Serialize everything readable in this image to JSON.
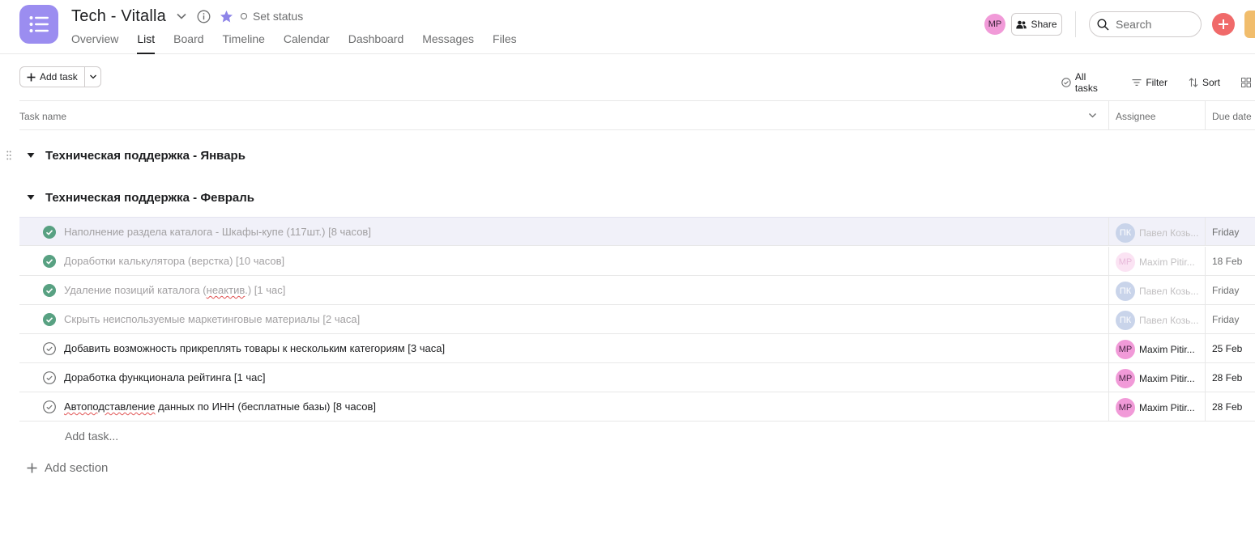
{
  "header": {
    "project_title": "Tech - Vitalla",
    "set_status_label": "Set status",
    "tabs": [
      {
        "label": "Overview"
      },
      {
        "label": "List"
      },
      {
        "label": "Board"
      },
      {
        "label": "Timeline"
      },
      {
        "label": "Calendar"
      },
      {
        "label": "Dashboard"
      },
      {
        "label": "Messages"
      },
      {
        "label": "Files"
      }
    ],
    "active_tab": "List",
    "user_initials": "MP",
    "share_label": "Share",
    "search_placeholder": "Search",
    "colors": {
      "app_icon": "#9b8df0",
      "star": "#8d84e8",
      "create_button": "#f06a6a",
      "upgrade": "#f1bd6c"
    }
  },
  "toolbar": {
    "add_task_label": "Add task",
    "all_tasks_label": "All tasks",
    "filter_label": "Filter",
    "sort_label": "Sort"
  },
  "columns": {
    "task_name": "Task name",
    "assignee": "Assignee",
    "due_date": "Due date"
  },
  "sections": [
    {
      "title": "Техническая поддержка - Январь",
      "tasks": []
    },
    {
      "title": "Техническая поддержка - Февраль",
      "tasks": [
        {
          "name": "Наполнение раздела каталога - Шкафы-купе (117шт.) [8 часов]",
          "completed": true,
          "assignee_initials": "ПК",
          "assignee_name": "Павел Козь...",
          "due": "Friday"
        },
        {
          "name": "Доработки калькулятора (верстка) [10 часов]",
          "completed": true,
          "assignee_initials": "MP",
          "assignee_name": "Maxim Pitir...",
          "due": "18 Feb"
        },
        {
          "name_parts": [
            "Удаление позиций каталога (",
            "неактив",
            ".) [1 час]"
          ],
          "completed": true,
          "assignee_initials": "ПК",
          "assignee_name": "Павел Козь...",
          "due": "Friday"
        },
        {
          "name": "Скрыть неиспользуемые маркетинговые материалы [2 часа]",
          "completed": true,
          "assignee_initials": "ПК",
          "assignee_name": "Павел Козь...",
          "due": "Friday"
        },
        {
          "name": "Добавить возможность прикреплять товары к нескольким категориям [3 часа]",
          "completed": false,
          "assignee_initials": "MP",
          "assignee_name": "Maxim Pitir...",
          "due": "25 Feb"
        },
        {
          "name": "Доработка функционала рейтинга [1 час]",
          "completed": false,
          "assignee_initials": "MP",
          "assignee_name": "Maxim Pitir...",
          "due": "28 Feb"
        },
        {
          "name_parts": [
            "Автоподставление",
            " данных по ИНН (бесплатные базы) [8 часов]"
          ],
          "completed": false,
          "assignee_initials": "MP",
          "assignee_name": "Maxim Pitir...",
          "due": "28 Feb"
        }
      ]
    }
  ],
  "add_task_inline": "Add task...",
  "add_section_label": "Add section"
}
